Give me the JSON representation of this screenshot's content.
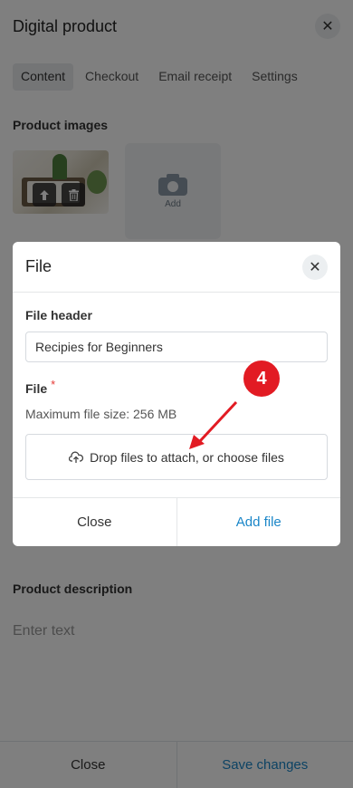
{
  "header": {
    "title": "Digital product",
    "close_glyph": "✕"
  },
  "tabs": [
    {
      "label": "Content",
      "active": true
    },
    {
      "label": "Checkout",
      "active": false
    },
    {
      "label": "Email receipt",
      "active": false
    },
    {
      "label": "Settings",
      "active": false
    }
  ],
  "images": {
    "label": "Product images",
    "add_label": "Add",
    "icons": [
      "upload-arrow-icon",
      "trash-icon",
      "camera-icon"
    ]
  },
  "description": {
    "label": "Product description",
    "placeholder": "Enter text"
  },
  "bottom_bar": {
    "close_label": "Close",
    "save_label": "Save changes"
  },
  "modal": {
    "title": "File",
    "close_glyph": "✕",
    "file_header_label": "File header",
    "file_header_value": "Recipies for Beginners",
    "file_label": "File",
    "required_mark": "*",
    "max_size_text": "Maximum file size: 256 MB",
    "dropzone_text": "Drop files to attach, or choose files",
    "close_label": "Close",
    "add_label": "Add file"
  },
  "annotation": {
    "step_number": "4"
  },
  "colors": {
    "accent": "#1a86c8",
    "badge": "#e21b23",
    "overlay": "rgba(0,0,0,0.5)"
  }
}
